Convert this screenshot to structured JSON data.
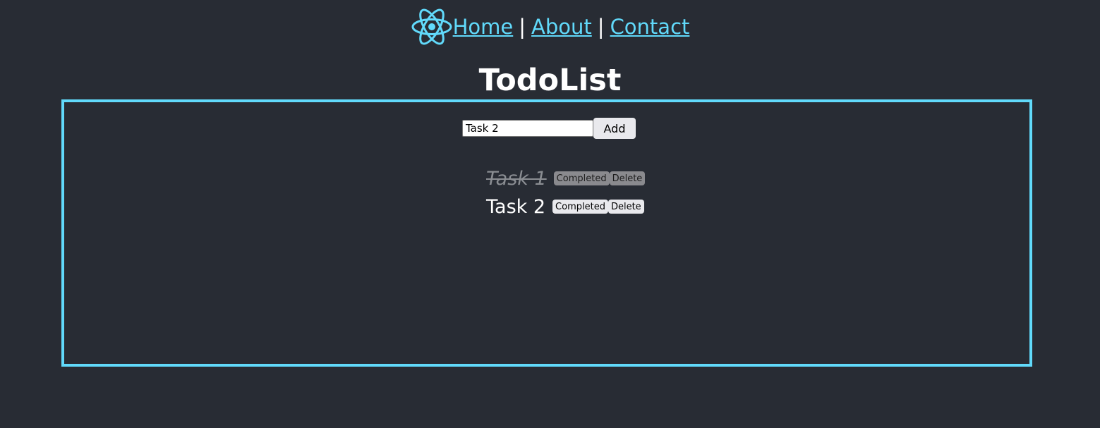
{
  "nav": {
    "links": [
      {
        "label": "Home"
      },
      {
        "label": "About"
      },
      {
        "label": "Contact"
      }
    ],
    "separator": "|",
    "logo_icon": "react-atom-icon"
  },
  "page": {
    "title": "TodoList"
  },
  "form": {
    "input_value": "Task 2",
    "add_label": "Add"
  },
  "todos": [
    {
      "text": "Task 1",
      "completed": true,
      "complete_label": "Completed",
      "delete_label": "Delete"
    },
    {
      "text": "Task 2",
      "completed": false,
      "complete_label": "Completed",
      "delete_label": "Delete"
    }
  ],
  "colors": {
    "background": "#282c34",
    "accent": "#61dafb",
    "text": "#ffffff",
    "completed_text": "#8a8d92"
  }
}
